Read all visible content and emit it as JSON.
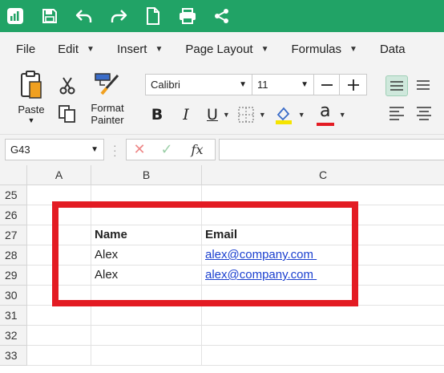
{
  "toolbar": {
    "icons": [
      "app-logo-icon",
      "save-icon",
      "undo-icon",
      "redo-icon",
      "new-document-icon",
      "print-icon",
      "share-icon"
    ]
  },
  "menu": {
    "items": [
      {
        "label": "File",
        "has_caret": false
      },
      {
        "label": "Edit",
        "has_caret": true
      },
      {
        "label": "Insert",
        "has_caret": true
      },
      {
        "label": "Page Layout",
        "has_caret": true
      },
      {
        "label": "Formulas",
        "has_caret": true
      },
      {
        "label": "Data",
        "has_caret": false
      }
    ]
  },
  "ribbon": {
    "paste_label": "Paste",
    "format_painter_label_1": "Format",
    "format_painter_label_2": "Painter",
    "font_name": "Calibri",
    "font_size": "11",
    "bold_label": "B",
    "italic_label": "I",
    "underline_label": "U",
    "font_color_label": "a",
    "highlight_color": "#f5e400",
    "font_color": "#e31b23"
  },
  "formula_bar": {
    "cell_reference": "G43",
    "cancel_symbol": "✕",
    "confirm_symbol": "✓",
    "fx_label": "fx",
    "formula_value": ""
  },
  "grid": {
    "columns": [
      "A",
      "B",
      "C"
    ],
    "rows": [
      {
        "num": "25",
        "b": "",
        "c": ""
      },
      {
        "num": "26",
        "b": "",
        "c": ""
      },
      {
        "num": "27",
        "b": "Name",
        "c": "Email"
      },
      {
        "num": "28",
        "b": "Alex",
        "c": "alex@company.com "
      },
      {
        "num": "29",
        "b": "Alex",
        "c": "alex@company.com "
      },
      {
        "num": "30",
        "b": "",
        "c": ""
      },
      {
        "num": "31",
        "b": "",
        "c": ""
      },
      {
        "num": "32",
        "b": "",
        "c": ""
      },
      {
        "num": "33",
        "b": "",
        "c": ""
      }
    ]
  },
  "colors": {
    "brand": "#21a366",
    "highlight_border": "#e31b23",
    "link": "#1a3fcf"
  }
}
